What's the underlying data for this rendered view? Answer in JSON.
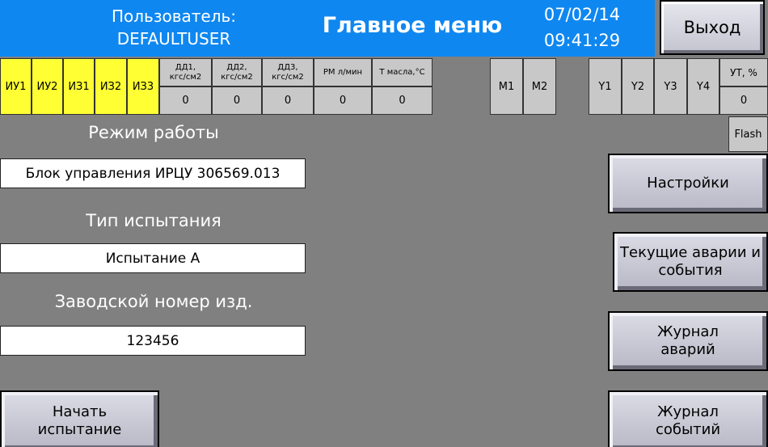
{
  "header": {
    "user_label": "Пользователь:",
    "user_name": "DEFAULTUSER",
    "title": "Главное меню",
    "date": "07/02/14",
    "time": "09:41:29",
    "exit_label": "Выход"
  },
  "indicators": {
    "yellow": [
      "ИУ1",
      "ИУ2",
      "ИЗ1",
      "ИЗ2",
      "ИЗ3"
    ],
    "sensors": [
      {
        "label": "ДД1,\nкгс/см2",
        "value": "0"
      },
      {
        "label": "ДД2,\nкгс/см2",
        "value": "0"
      },
      {
        "label": "ДД3,\nкгс/см2",
        "value": "0"
      },
      {
        "label": "РМ л/мин",
        "value": "0"
      },
      {
        "label": "Т масла,°С",
        "value": "0"
      }
    ],
    "motors": [
      "М1",
      "М2"
    ],
    "valves": [
      "Y1",
      "Y2",
      "Y3",
      "Y4"
    ],
    "ut": {
      "label": "УТ, %",
      "value": "0"
    },
    "flash": "Flash"
  },
  "left": {
    "mode_label": "Режим работы",
    "mode_value": "Блок управления ИРЦУ 306569.013",
    "test_type_label": "Тип испытания",
    "test_type_value": "Испытание А",
    "serial_label": "Заводской номер изд.",
    "serial_value": "123456",
    "start_button": "Начать\nиспытание"
  },
  "right": {
    "settings_button": "Настройки",
    "alarms_button": "Текущие аварии и\nсобытия",
    "alarm_log_button": "Журнал\nаварий",
    "event_log_button": "Журнал\nсобытий"
  },
  "colors": {
    "header_bg": "#0f87f0",
    "panel_bg": "#808080",
    "indicator_active": "#ffff33",
    "indicator_inactive": "#c8c8c8"
  }
}
